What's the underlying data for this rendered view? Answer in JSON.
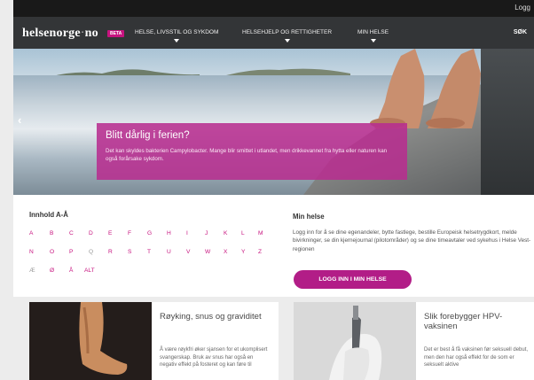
{
  "colors": {
    "brand": "#c7137f",
    "nav_background": "#333537",
    "topbar_background": "#191919",
    "button": "#b21d87"
  },
  "topbar": {
    "login_label": "Logg"
  },
  "nav": {
    "logo_main": "helsenorge",
    "logo_dot": "·",
    "logo_tld": "no",
    "beta_label": "BETA",
    "items": [
      {
        "label": "HELSE, LIVSSTIL OG SYKDOM"
      },
      {
        "label": "HELSEHJELP OG RETTIGHETER"
      },
      {
        "label": "MIN HELSE"
      }
    ],
    "search_label": "SØK"
  },
  "hero": {
    "prev_icon": "‹",
    "title": "Blitt dårlig i ferien?",
    "text": "Det kan skyldes bakterien Campylobacter. Mange blir smittet i utlandet, men drikkevannet fra hytta eller naturen kan også forårsake sykdom."
  },
  "az": {
    "heading": "Innhold A-Å",
    "letters": [
      "A",
      "B",
      "C",
      "D",
      "E",
      "F",
      "G",
      "H",
      "I",
      "J",
      "K",
      "L",
      "M",
      "N",
      "O",
      "P",
      "Q",
      "R",
      "S",
      "T",
      "U",
      "V",
      "W",
      "X",
      "Y",
      "Z",
      "Æ",
      "Ø",
      "Å",
      "ALT"
    ]
  },
  "min_helse": {
    "heading": "Min helse",
    "text": "Logg inn for å se dine egenandeler, bytte fastlege, bestille Europeisk helsetrygdkort, melde bivirkninger, se din kjernejournal (pilotområder) og se dine timeavtaler ved sykehus i Helse Vest-regionen",
    "button_label": "LOGG INN I MIN HELSE"
  },
  "cards": [
    {
      "title": "Røyking, snus og graviditet",
      "text": "Å være røykfri øker sjansen for et ukomplisert svangerskap. Bruk av snus har også en negativ effekt på fosteret og kan føre til"
    },
    {
      "title": "Slik forebygger HPV-vaksinen",
      "text": "Det er best å få vaksinen før seksuell debut, men den har også effekt for de som er seksuelt aktive"
    }
  ]
}
